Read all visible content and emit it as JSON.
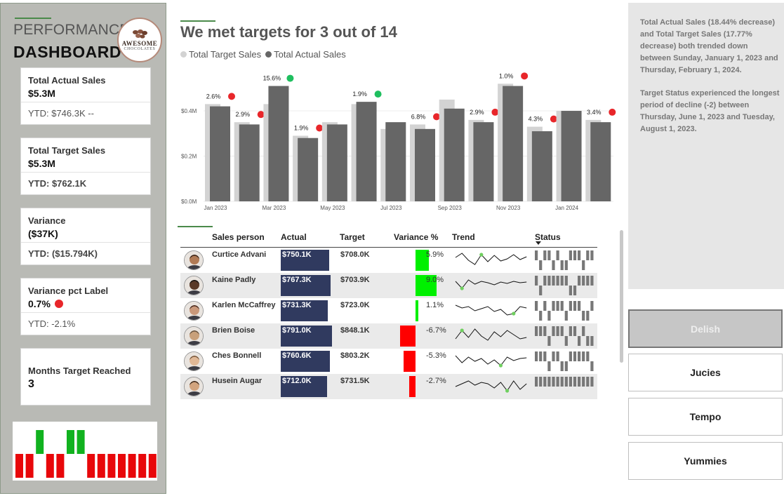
{
  "header": {
    "performance_label": "PERFORMANCE",
    "dashboard_label": "DASHBOARD",
    "logo_line1": "AWESOME",
    "logo_line2": "CHOCOLATES"
  },
  "kpis": {
    "actual": {
      "label": "Total Actual Sales",
      "value": "$5.3M",
      "ytd": "YTD: $746.3K --"
    },
    "target": {
      "label": "Total Target Sales",
      "value": "$5.3M",
      "ytd": "YTD: $762.1K"
    },
    "variance": {
      "label": "Variance",
      "value": "($37K)",
      "ytd": "YTD: ($15.794K)"
    },
    "variance_pct": {
      "label": "Variance pct Label",
      "value": "0.7%",
      "ytd": "YTD: -2.1%",
      "status_color": "#e8262a"
    },
    "months": {
      "label": "Months Target Reached",
      "value": "3"
    }
  },
  "month_status": [
    false,
    false,
    true,
    false,
    false,
    true,
    true,
    false,
    false,
    false,
    false,
    false,
    false,
    false
  ],
  "chart": {
    "title": "We met targets for 3 out of 14",
    "legend": [
      {
        "name": "Total Target Sales",
        "color": "#d3d3d3"
      },
      {
        "name": "Total Actual Sales",
        "color": "#666666"
      }
    ]
  },
  "chart_data": {
    "type": "bar",
    "categories": [
      "Jan 2023",
      "Feb 2023",
      "Mar 2023",
      "Apr 2023",
      "May 2023",
      "Jun 2023",
      "Jul 2023",
      "Aug 2023",
      "Sep 2023",
      "Oct 2023",
      "Nov 2023",
      "Dec 2023",
      "Jan 2024",
      "Feb 2024"
    ],
    "x_tick_labels": [
      "Jan 2023",
      "Mar 2023",
      "May 2023",
      "Jul 2023",
      "Sep 2023",
      "Nov 2023",
      "Jan 2024"
    ],
    "y_tick_labels": [
      "$0.0M",
      "$0.2M",
      "$0.4M"
    ],
    "ylim": [
      0,
      0.58
    ],
    "series": [
      {
        "name": "Total Target Sales",
        "color": "#d3d3d3",
        "values": [
          0.43,
          0.35,
          0.43,
          0.29,
          0.35,
          0.43,
          0.32,
          0.34,
          0.45,
          0.36,
          0.52,
          0.33,
          0.4,
          0.36
        ]
      },
      {
        "name": "Total Actual Sales",
        "color": "#666666",
        "values": [
          0.42,
          0.34,
          0.51,
          0.28,
          0.34,
          0.44,
          0.35,
          0.32,
          0.41,
          0.35,
          0.51,
          0.31,
          0.4,
          0.35
        ]
      }
    ],
    "data_labels": [
      "2.6%",
      "2.9%",
      "15.6%",
      "1.9%",
      "",
      "1.9%",
      "",
      "6.8%",
      "",
      "2.9%",
      "1.0%",
      "4.3%",
      "",
      "3.4%"
    ],
    "label_status": [
      "red",
      "red",
      "green",
      "red",
      "",
      "green",
      "",
      "red",
      "",
      "red",
      "red",
      "red",
      "",
      "red"
    ],
    "status_colors": {
      "red": "#e8262a",
      "green": "#1fbf5f"
    }
  },
  "table": {
    "headers": [
      "Sales person",
      "Actual",
      "Target",
      "Variance %",
      "Trend",
      "Status"
    ],
    "rows": [
      {
        "name": "Curtice Advani",
        "actual": "$750.1K",
        "actual_frac": 0.95,
        "target": "$708.0K",
        "variance": "5.9%",
        "variance_value": 5.9,
        "trend": [
          14,
          20,
          10,
          4,
          18,
          8,
          17,
          9,
          12,
          18,
          11,
          15
        ],
        "trend_marker": 4,
        "status": [
          1,
          0,
          1,
          1,
          0,
          1,
          0,
          0,
          1,
          1,
          1,
          0,
          1,
          1
        ],
        "avatar_skin": "#b07a55",
        "avatar_hair": "#2a1a12"
      },
      {
        "name": "Kaine Padly",
        "actual": "$767.3K",
        "actual_frac": 0.97,
        "target": "$703.9K",
        "variance": "9.0%",
        "variance_value": 9.0,
        "trend": [
          16,
          6,
          18,
          12,
          16,
          14,
          11,
          15,
          13,
          16,
          14,
          15
        ],
        "trend_marker": 1,
        "status": [
          1,
          0,
          1,
          1,
          1,
          1,
          1,
          1,
          0,
          0,
          1,
          1,
          1,
          1
        ],
        "avatar_skin": "#5a3a28",
        "avatar_hair": "#111111"
      },
      {
        "name": "Karlen McCaffrey",
        "actual": "$731.3K",
        "actual_frac": 0.92,
        "target": "$723.0K",
        "variance": "1.1%",
        "variance_value": 1.1,
        "trend": [
          18,
          14,
          16,
          10,
          13,
          16,
          9,
          12,
          4,
          6,
          16,
          14
        ],
        "trend_marker": 9,
        "status": [
          1,
          0,
          1,
          0,
          1,
          1,
          1,
          0,
          1,
          1,
          1,
          0,
          0,
          1
        ],
        "avatar_skin": "#c9987a",
        "avatar_hair": "#3a1e16"
      },
      {
        "name": "Brien Boise",
        "actual": "$791.0K",
        "actual_frac": 1.0,
        "target": "$848.1K",
        "variance": "-6.7%",
        "variance_value": -6.7,
        "trend": [
          6,
          18,
          8,
          20,
          10,
          4,
          16,
          9,
          18,
          12,
          6,
          8
        ],
        "trend_marker": 1,
        "status": [
          1,
          1,
          1,
          0,
          1,
          1,
          1,
          0,
          1,
          1,
          0,
          1,
          0,
          0
        ],
        "avatar_skin": "#c8a07a",
        "avatar_hair": "#5a4a3a"
      },
      {
        "name": "Ches Bonnell",
        "actual": "$760.6K",
        "actual_frac": 0.96,
        "target": "$803.2K",
        "variance": "-5.3%",
        "variance_value": -5.3,
        "trend": [
          18,
          8,
          16,
          10,
          14,
          6,
          12,
          4,
          16,
          11,
          14,
          15
        ],
        "trend_marker": 7,
        "status": [
          1,
          1,
          1,
          0,
          1,
          1,
          0,
          0,
          1,
          1,
          1,
          1,
          1,
          0
        ],
        "avatar_skin": "#e0b896",
        "avatar_hair": "#6a4a30"
      },
      {
        "name": "Husein Augar",
        "actual": "$712.0K",
        "actual_frac": 0.9,
        "target": "$731.5K",
        "variance": "-2.7%",
        "variance_value": -2.7,
        "trend": [
          10,
          14,
          18,
          12,
          16,
          14,
          8,
          16,
          4,
          18,
          6,
          14
        ],
        "trend_marker": 8,
        "status": [
          1,
          1,
          1,
          1,
          1,
          1,
          1,
          1,
          1,
          1,
          1,
          1,
          1,
          1
        ],
        "avatar_skin": "#d2a47e",
        "avatar_hair": "#2a1a10"
      }
    ]
  },
  "insights": [
    "Total Actual Sales (18.44% decrease) and Total Target Sales (17.77% decrease) both trended down between Sunday, January 1, 2023 and Thursday, February 1, 2024.",
    "Target Status experienced the longest period of decline (-2) between Thursday, June 1, 2023 and Tuesday, August 1, 2023."
  ],
  "slicers": [
    {
      "label": "Delish",
      "selected": true
    },
    {
      "label": "Jucies",
      "selected": false
    },
    {
      "label": "Tempo",
      "selected": false
    },
    {
      "label": "Yummies",
      "selected": false
    }
  ]
}
